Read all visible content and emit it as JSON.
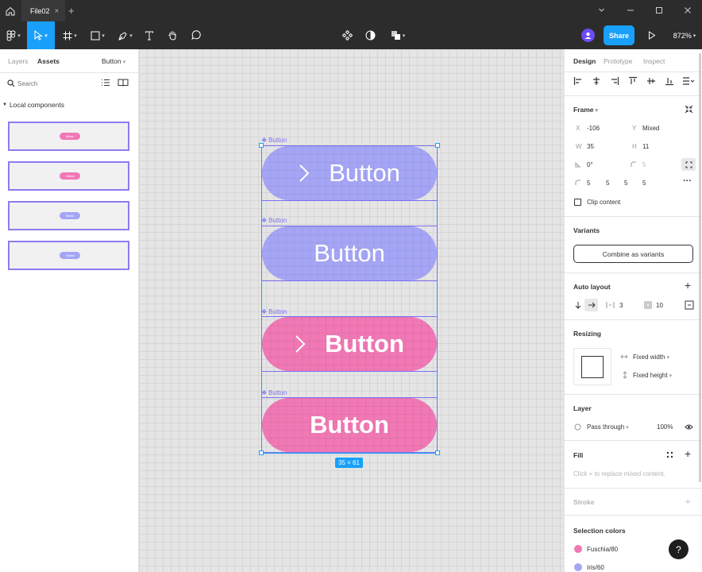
{
  "titlebar": {
    "tab_name": "File02",
    "tab_close": "✕",
    "add_tab": "+"
  },
  "toolbar": {
    "share_label": "Share",
    "zoom": "872%"
  },
  "left_panel": {
    "tabs": [
      "Layers",
      "Assets"
    ],
    "library_name": "Button",
    "search_placeholder": "Search",
    "section_title": "Local components",
    "thumbnails": [
      {
        "label": "Button",
        "color": "#f078b4"
      },
      {
        "label": "› Button",
        "color": "#f078b4"
      },
      {
        "label": "Button",
        "color": "#a5a5f5"
      },
      {
        "label": "› Button",
        "color": "#a5a5f5"
      }
    ]
  },
  "canvas": {
    "components": [
      {
        "label": "Button",
        "text": "Button",
        "has_chevron": true,
        "style": "iris"
      },
      {
        "label": "Button",
        "text": "Button",
        "has_chevron": false,
        "style": "iris"
      },
      {
        "label": "Button",
        "text": "Button",
        "has_chevron": true,
        "style": "fuschia"
      },
      {
        "label": "Button",
        "text": "Button",
        "has_chevron": false,
        "style": "fuschia"
      }
    ],
    "size_badge": "35 × 61",
    "colors": {
      "iris": "#a5a5f5",
      "fuschia": "#f078b4",
      "selection": "#18a0fb"
    }
  },
  "right_panel": {
    "tabs": [
      "Design",
      "Prototype",
      "Inspect"
    ],
    "frame": {
      "title": "Frame",
      "x_label": "X",
      "x_value": "-106",
      "y_label": "Y",
      "y_value": "Mixed",
      "w_label": "W",
      "w_value": "35",
      "h_label": "H",
      "h_value": "11",
      "rotation": "0°",
      "radius": "5",
      "radius_tl": "5",
      "radius_tr": "5",
      "radius_br": "5",
      "radius_bl": "5",
      "clip_content": "Clip content"
    },
    "variants": {
      "title": "Variants",
      "combine_label": "Combine as variants"
    },
    "auto_layout": {
      "title": "Auto layout",
      "spacing": "3",
      "padding": "10"
    },
    "resizing": {
      "title": "Resizing",
      "width_mode": "Fixed width",
      "height_mode": "Fixed height"
    },
    "layer": {
      "title": "Layer",
      "blend": "Pass through",
      "opacity": "100%"
    },
    "fill": {
      "title": "Fill",
      "hint": "Click + to replace mixed content."
    },
    "stroke": {
      "title": "Stroke"
    },
    "selection_colors": {
      "title": "Selection colors",
      "items": [
        {
          "name": "Fuschia/80",
          "color": "#f078b4"
        },
        {
          "name": "Iris/60",
          "color": "#a5a5f5"
        }
      ]
    },
    "help": "?"
  }
}
